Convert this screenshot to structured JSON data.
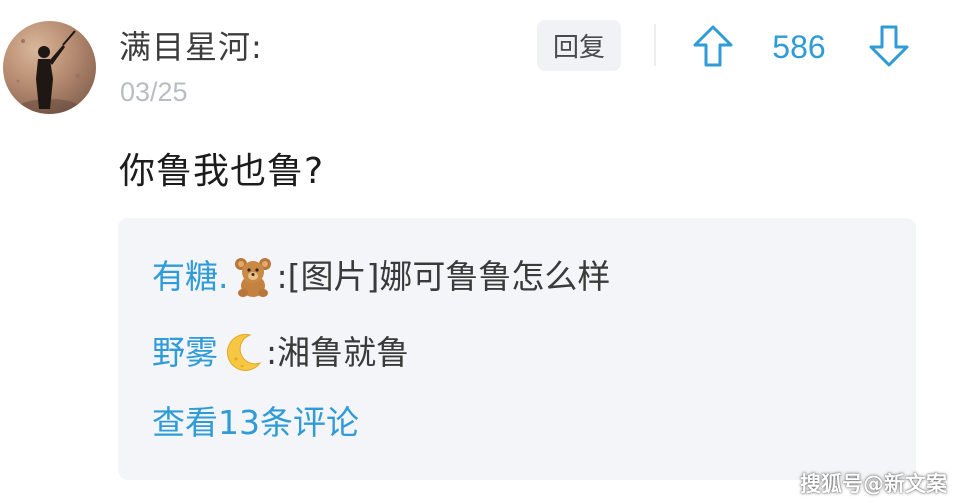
{
  "comment": {
    "username": "满目星河:",
    "date": "03/25",
    "text": "你鲁我也鲁?",
    "avatar_icon": "silhouette-avatar"
  },
  "actions": {
    "reply_label": "回复",
    "upvote_icon": "arrow-up-icon",
    "vote_count": "586",
    "downvote_icon": "arrow-down-icon"
  },
  "replies": [
    {
      "user": "有糖.",
      "user_emoji": "teddy-bear-emoji",
      "separator": ":",
      "text": "[图片]娜可鲁鲁怎么样"
    },
    {
      "user": "野雾",
      "user_emoji": "crescent-moon-emoji",
      "separator": ":",
      "text": "湘鲁就鲁"
    }
  ],
  "more_comments_label": "查看13条评论",
  "watermark": "搜狐号@新文案",
  "colors": {
    "accent": "#2f9bd7",
    "reply_bg": "#f4f5f8",
    "button_bg": "#f1f2f6",
    "date_gray": "#b9bcc3"
  }
}
